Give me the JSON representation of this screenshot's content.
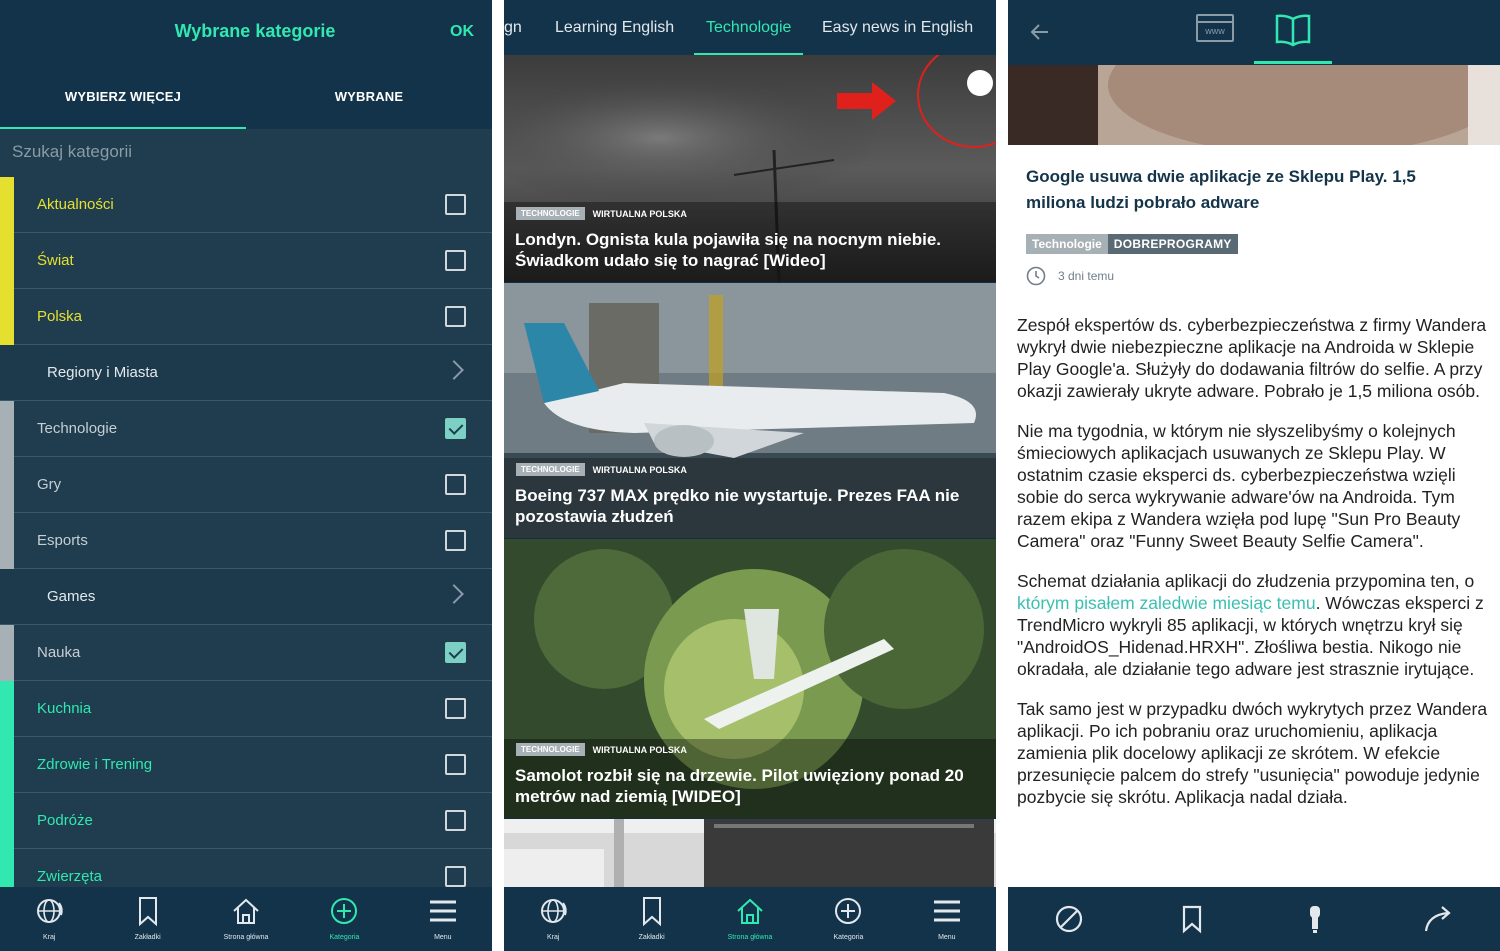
{
  "panel1": {
    "title": "Wybrane kategorie",
    "ok_label": "OK",
    "tabs": [
      {
        "label": "WYBIERZ WIĘCEJ"
      },
      {
        "label": "WYBRANE"
      }
    ],
    "search_placeholder": "Szukaj kategorii",
    "categories": [
      {
        "label": "Aktualności",
        "checked": false,
        "group_color": "#e5e030",
        "label_color": "#e5e030",
        "kind": "checkbox"
      },
      {
        "label": "Świat",
        "checked": false,
        "group_color": "#e5e030",
        "label_color": "#e5e030",
        "kind": "checkbox"
      },
      {
        "label": "Polska",
        "checked": false,
        "group_color": "#e5e030",
        "label_color": "#e5e030",
        "kind": "checkbox"
      },
      {
        "label": "Regiony i Miasta",
        "kind": "submenu"
      },
      {
        "label": "Technologie",
        "checked": true,
        "group_color": "#a7b0b5",
        "label_color": "#c6ced3",
        "kind": "checkbox"
      },
      {
        "label": "Gry",
        "checked": false,
        "group_color": "#a7b0b5",
        "label_color": "#c6ced3",
        "kind": "checkbox"
      },
      {
        "label": "Esports",
        "checked": false,
        "group_color": "#a7b0b5",
        "label_color": "#c6ced3",
        "kind": "checkbox"
      },
      {
        "label": "Games",
        "kind": "submenu"
      },
      {
        "label": "Nauka",
        "checked": true,
        "group_color": "#a7b0b5",
        "label_color": "#c6ced3",
        "kind": "checkbox"
      },
      {
        "label": "Kuchnia",
        "checked": false,
        "group_color": "#30e8b0",
        "label_color": "#30e8b0",
        "kind": "checkbox"
      },
      {
        "label": "Zdrowie i Trening",
        "checked": false,
        "group_color": "#30e8b0",
        "label_color": "#30e8b0",
        "kind": "checkbox"
      },
      {
        "label": "Podróże",
        "checked": false,
        "group_color": "#30e8b0",
        "label_color": "#30e8b0",
        "kind": "checkbox"
      },
      {
        "label": "Zwierzęta",
        "checked": false,
        "group_color": "#30e8b0",
        "label_color": "#30e8b0",
        "kind": "checkbox"
      }
    ],
    "bottom_nav": [
      {
        "label": "Kraj",
        "icon": "globe-icon",
        "active": false
      },
      {
        "label": "Zakładki",
        "icon": "bookmark-icon",
        "active": false
      },
      {
        "label": "Strona główna",
        "icon": "home-icon",
        "active": false
      },
      {
        "label": "Kategoria",
        "icon": "plus-circle-icon",
        "active": true
      },
      {
        "label": "Menu",
        "icon": "menu-icon",
        "active": false
      }
    ]
  },
  "panel2": {
    "tabs": [
      {
        "label": "gn",
        "active": false
      },
      {
        "label": "Learning English",
        "active": false
      },
      {
        "label": "Technologie",
        "active": true
      },
      {
        "label": "Easy news in English",
        "active": false
      }
    ],
    "articles": [
      {
        "category": "TECHNOLOGIE",
        "source": "WIRTUALNA POLSKA",
        "title": "Londyn. Ognista kula pojawiła się na nocnym niebie. Świadkom udało się to nagrać [Wideo]"
      },
      {
        "category": "TECHNOLOGIE",
        "source": "WIRTUALNA POLSKA",
        "title": "Boeing 737 MAX prędko nie wystartuje. Prezes FAA nie pozostawia złudzeń"
      },
      {
        "category": "TECHNOLOGIE",
        "source": "WIRTUALNA POLSKA",
        "title": "Samolot rozbił się na drzewie. Pilot uwięziony ponad 20 metrów nad ziemią [WIDEO]"
      }
    ],
    "bottom_nav": [
      {
        "label": "Kraj",
        "icon": "globe-icon",
        "active": false
      },
      {
        "label": "Zakładki",
        "icon": "bookmark-icon",
        "active": false
      },
      {
        "label": "Strona główna",
        "icon": "home-icon",
        "active": true
      },
      {
        "label": "Kategoria",
        "icon": "plus-circle-icon",
        "active": false
      },
      {
        "label": "Menu",
        "icon": "menu-icon",
        "active": false
      }
    ]
  },
  "panel3": {
    "www_label": "www",
    "headline": "Google usuwa dwie aplikacje ze Sklepu Play. 1,5 miliona ludzi pobrało adware",
    "category": "Technologie",
    "source": "DOBREPROGRAMY",
    "time": "3 dni temu",
    "paragraph1": "Zespół ekspertów ds. cyberbezpieczeństwa z firmy Wandera wykrył dwie niebezpieczne aplikacje na Androida w Sklepie Play Google'a. Służyły do dodawania filtrów do selfie. A przy okazji zawierały ukryte adware. Pobrało je 1,5 miliona osób.",
    "paragraph2": "Nie ma tygodnia, w którym nie słyszelibyśmy o kolejnych śmieciowych aplikacjach usuwanych ze Sklepu Play. W ostatnim czasie eksperci ds. cyberbezpieczeństwa wzięli sobie do serca wykrywanie adware'ów na Androida. Tym razem ekipa z Wandera wzięła pod lupę \"Sun Pro Beauty Camera\" oraz \"Funny Sweet Beauty Selfie Camera\".",
    "paragraph3_before": "Schemat działania aplikacji do złudzenia przypomina ten, o ",
    "paragraph3_link": "którym pisałem zaledwie miesiąc temu",
    "paragraph3_after": ". Wówczas eksperci z TrendMicro wykryli 85 aplikacji, w których wnętrzu krył się \"AndroidOS_Hidenad.HRXH\". Złośliwa bestia. Nikogo nie okradała, ale działanie tego adware jest strasznie irytujące.",
    "paragraph4": "Tak samo jest w przypadku dwóch wykrytych przez Wandera aplikacji. Po ich pobraniu oraz uruchomieniu, aplikacja zamienia plik docelowy aplikacji ze skrótem. W efekcie przesunięcie palcem do strefy \"usunięcia\" powoduje jedynie pozbycie się skrótu. Aplikacja nadal działa."
  },
  "colors": {
    "accent": "#30e8b0",
    "header_dark": "#13334a",
    "panel_bg": "#1f3d4e",
    "yellow": "#e5e030",
    "gray_group": "#a7b0b5"
  }
}
